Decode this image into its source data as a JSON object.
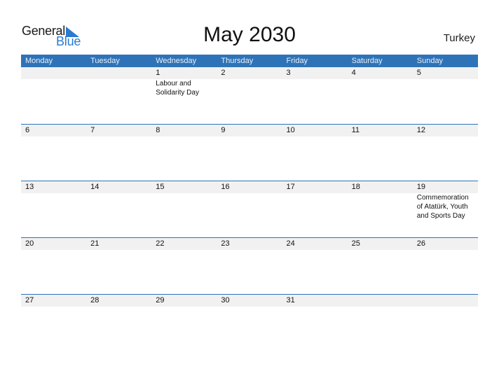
{
  "logo": {
    "line1": "General",
    "line2": "Blue"
  },
  "title": "May 2030",
  "country": "Turkey",
  "colors": {
    "header_bg": "#2e73b8",
    "brand_blue": "#2a7bd0",
    "day_band": "#f1f1f1"
  },
  "weekdays": [
    "Monday",
    "Tuesday",
    "Wednesday",
    "Thursday",
    "Friday",
    "Saturday",
    "Sunday"
  ],
  "weeks": [
    [
      {
        "day": "",
        "event": ""
      },
      {
        "day": "",
        "event": ""
      },
      {
        "day": "1",
        "event": "Labour and Solidarity Day"
      },
      {
        "day": "2",
        "event": ""
      },
      {
        "day": "3",
        "event": ""
      },
      {
        "day": "4",
        "event": ""
      },
      {
        "day": "5",
        "event": ""
      }
    ],
    [
      {
        "day": "6",
        "event": ""
      },
      {
        "day": "7",
        "event": ""
      },
      {
        "day": "8",
        "event": ""
      },
      {
        "day": "9",
        "event": ""
      },
      {
        "day": "10",
        "event": ""
      },
      {
        "day": "11",
        "event": ""
      },
      {
        "day": "12",
        "event": ""
      }
    ],
    [
      {
        "day": "13",
        "event": ""
      },
      {
        "day": "14",
        "event": ""
      },
      {
        "day": "15",
        "event": ""
      },
      {
        "day": "16",
        "event": ""
      },
      {
        "day": "17",
        "event": ""
      },
      {
        "day": "18",
        "event": ""
      },
      {
        "day": "19",
        "event": "Commemoration of Atatürk, Youth and Sports Day"
      }
    ],
    [
      {
        "day": "20",
        "event": ""
      },
      {
        "day": "21",
        "event": ""
      },
      {
        "day": "22",
        "event": ""
      },
      {
        "day": "23",
        "event": ""
      },
      {
        "day": "24",
        "event": ""
      },
      {
        "day": "25",
        "event": ""
      },
      {
        "day": "26",
        "event": ""
      }
    ],
    [
      {
        "day": "27",
        "event": ""
      },
      {
        "day": "28",
        "event": ""
      },
      {
        "day": "29",
        "event": ""
      },
      {
        "day": "30",
        "event": ""
      },
      {
        "day": "31",
        "event": ""
      },
      {
        "day": "",
        "event": ""
      },
      {
        "day": "",
        "event": ""
      }
    ]
  ]
}
